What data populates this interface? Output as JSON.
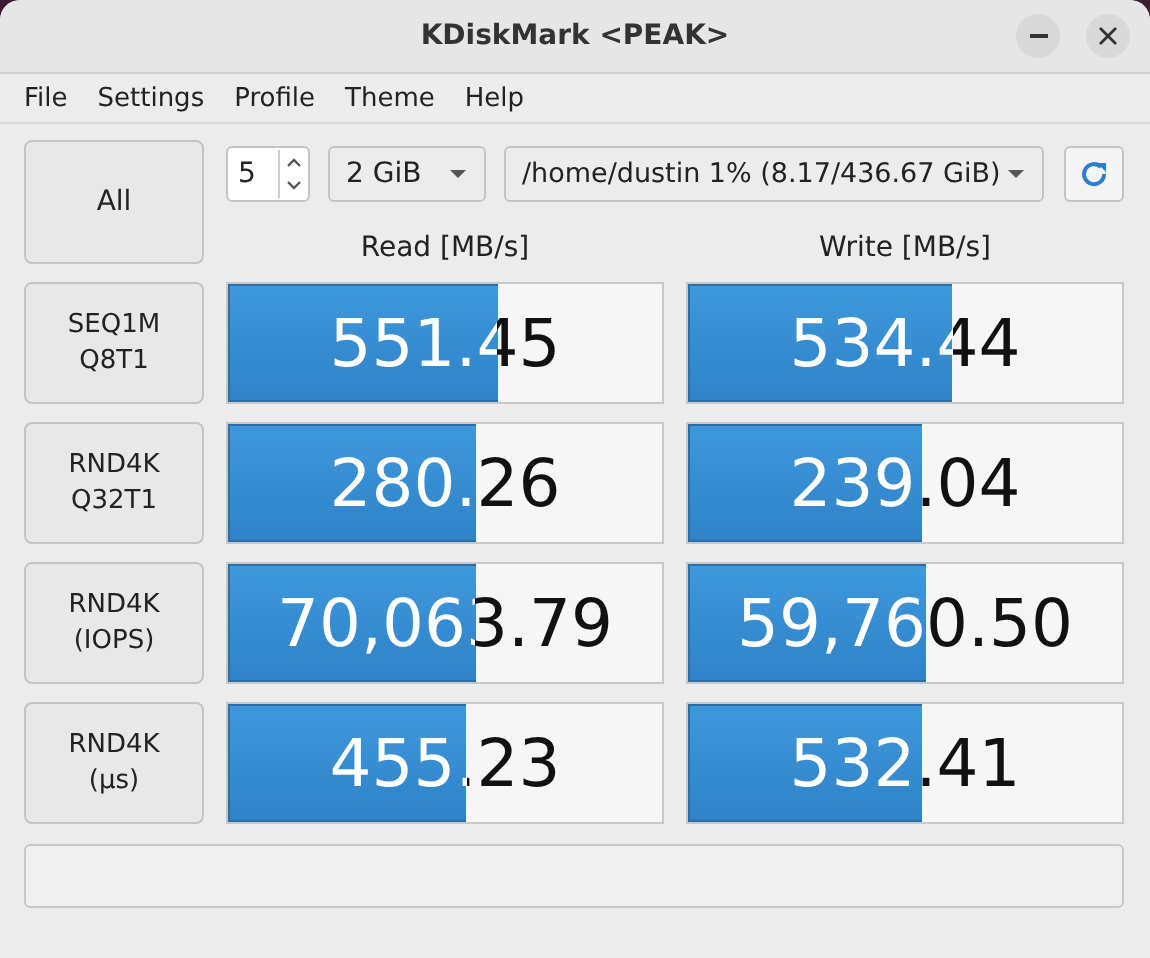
{
  "window": {
    "title": "KDiskMark <PEAK>"
  },
  "menu": [
    "File",
    "Settings",
    "Profile",
    "Theme",
    "Help"
  ],
  "toolbar": {
    "all_button": "All",
    "runs": "5",
    "size": "2 GiB",
    "target": "/home/dustin 1% (8.17/436.67 GiB)"
  },
  "columns": [
    "Read [MB/s]",
    "Write [MB/s]"
  ],
  "rows": [
    {
      "label": "SEQ1M\nQ8T1",
      "read": {
        "value": "551.45",
        "level": 0.62
      },
      "write": {
        "value": "534.44",
        "level": 0.61
      }
    },
    {
      "label": "RND4K\nQ32T1",
      "read": {
        "value": "280.26",
        "level": 0.57
      },
      "write": {
        "value": "239.04",
        "level": 0.54
      }
    },
    {
      "label": "RND4K\n(IOPS)",
      "read": {
        "value": "70,063.79",
        "level": 0.57
      },
      "write": {
        "value": "59,760.50",
        "level": 0.55
      }
    },
    {
      "label": "RND4K\n(μs)",
      "read": {
        "value": "455.23",
        "level": 0.55
      },
      "write": {
        "value": "532.41",
        "level": 0.54
      }
    }
  ]
}
